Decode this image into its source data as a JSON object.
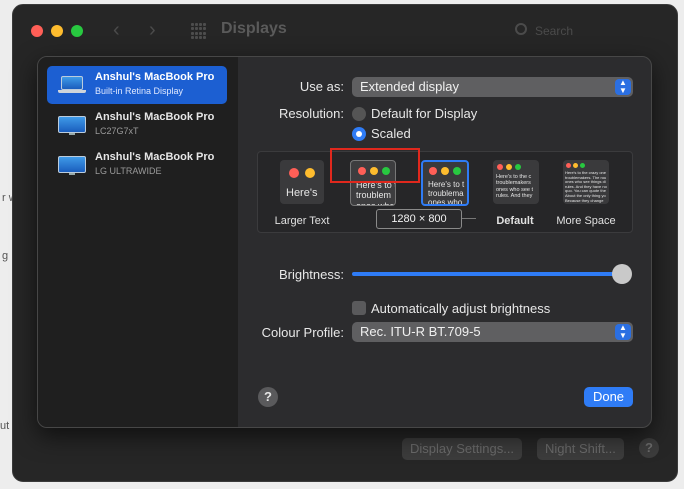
{
  "background": {
    "fragments": [
      "r w",
      "g",
      "ut"
    ]
  },
  "window": {
    "title": "Displays",
    "search_placeholder": "Search",
    "traffic_lights": [
      "#ff5f57",
      "#febc2e",
      "#28c840"
    ],
    "bottom_buttons": {
      "display_settings": "Display Settings...",
      "night_shift": "Night Shift...",
      "help": "?"
    }
  },
  "sidebar": {
    "items": [
      {
        "name": "Anshul's MacBook Pro",
        "subtitle": "Built-in Retina Display",
        "icon": "laptop-icon",
        "selected": true
      },
      {
        "name": "Anshul's MacBook Pro",
        "subtitle": "LC27G7xT",
        "icon": "monitor-icon",
        "selected": false
      },
      {
        "name": "Anshul's MacBook Pro",
        "subtitle": "LG ULTRAWIDE",
        "icon": "monitor-icon",
        "selected": false
      }
    ]
  },
  "settings": {
    "use_as_label": "Use as:",
    "use_as_value": "Extended display",
    "resolution_label": "Resolution:",
    "resolution_options": [
      "Default for Display",
      "Scaled"
    ],
    "resolution_selected": "Scaled",
    "scaled_options": [
      {
        "label": "Larger Text",
        "preview": "Here's",
        "bold": false
      },
      {
        "label": "",
        "preview": "Here's to t\ntroublem\nones who",
        "bold": false
      },
      {
        "label": "",
        "preview": "Here's to t\ntroublema\nones who",
        "bold": false
      },
      {
        "label": "Default",
        "preview": "Here's to the c\ntroublemakers\nones who see t\nrules. And they",
        "bold": true
      },
      {
        "label": "More Space",
        "preview": "Here's to the crazy one\ntroublemakers. The rou\nones who see things di\nrules. And they have no\nquo. You can quote the\nAbout the only thing yo\nBecause they change",
        "bold": false
      }
    ],
    "selected_resolution": "1280 × 800",
    "brightness_label": "Brightness:",
    "brightness_level": 1.0,
    "auto_brightness_label": "Automatically adjust brightness",
    "auto_brightness_checked": false,
    "colour_profile_label": "Colour Profile:",
    "colour_profile_value": "Rec. ITU-R BT.709-5",
    "help_label": "?",
    "done_label": "Done"
  },
  "colors": {
    "accent": "#2f7cf6",
    "highlight_box": "#e0281d"
  }
}
